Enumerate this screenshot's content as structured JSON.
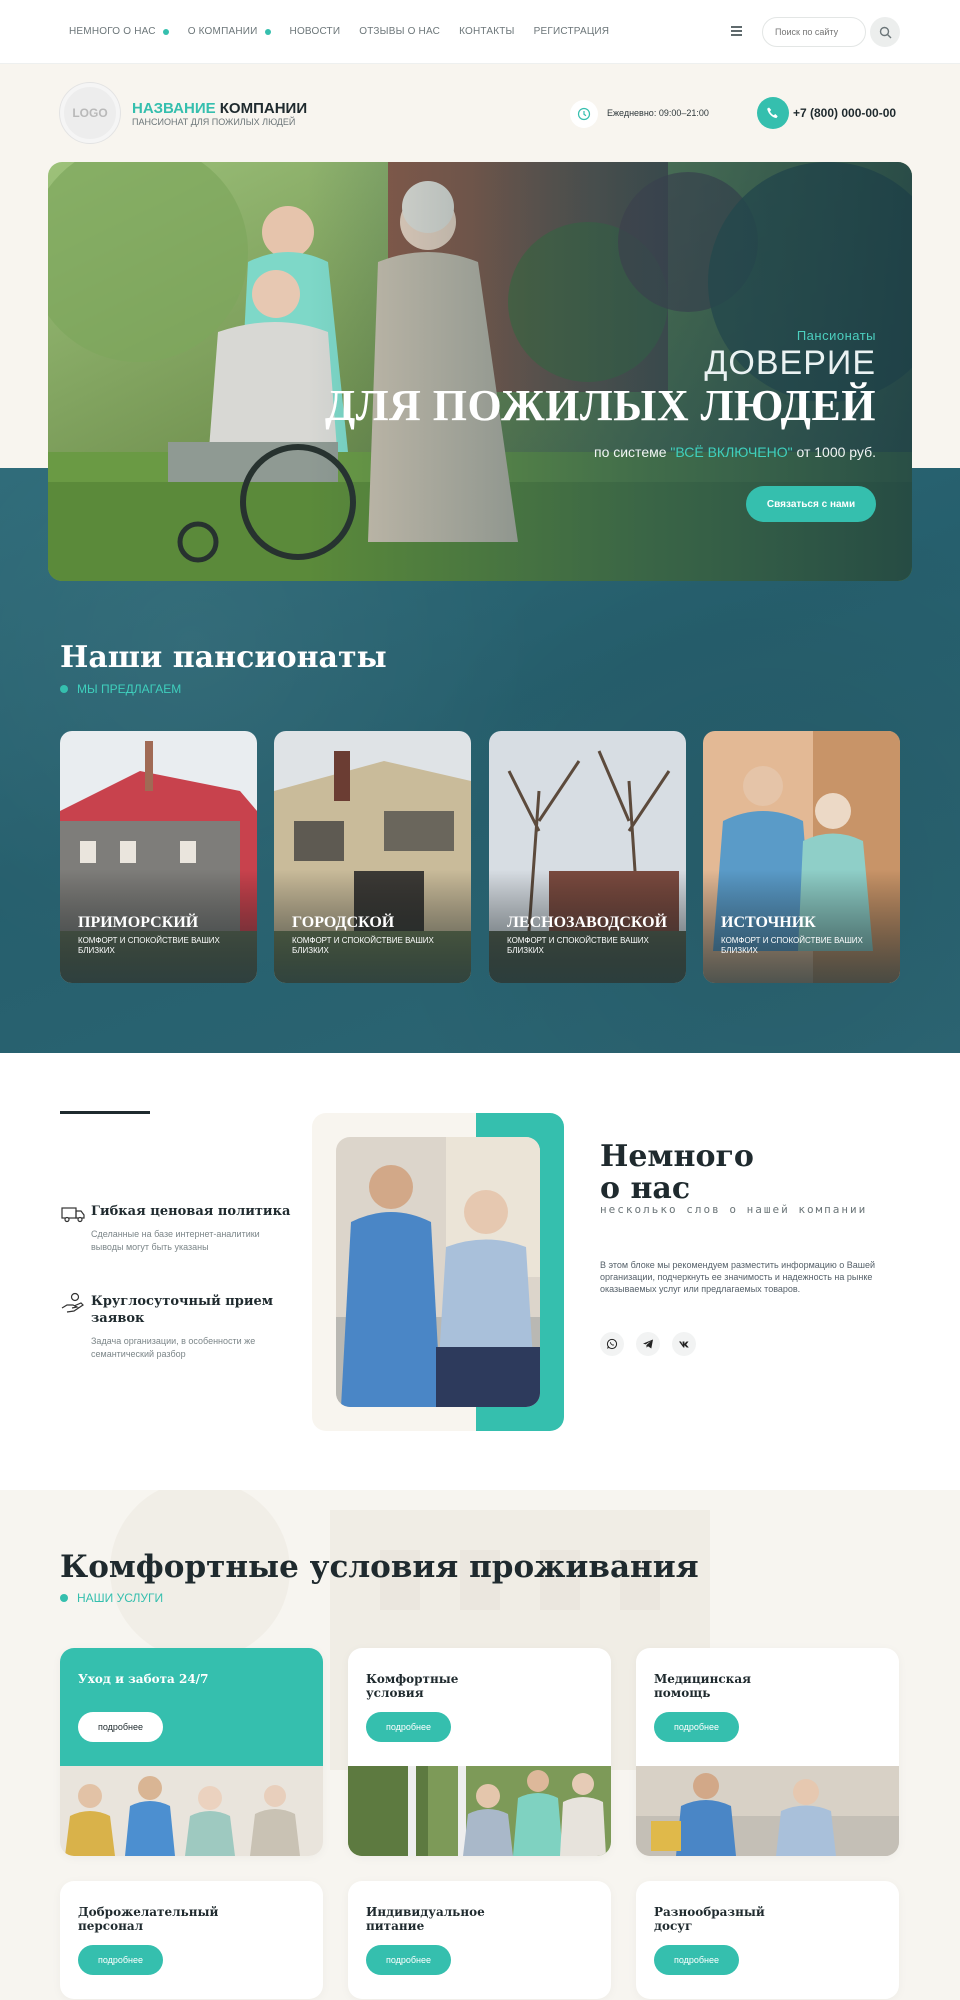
{
  "nav": {
    "items": [
      {
        "label": "НЕМНОГО О НАС",
        "dot": true
      },
      {
        "label": "О КОМПАНИИ",
        "dot": true
      },
      {
        "label": "НОВОСТИ",
        "dot": false
      },
      {
        "label": "ОТЗЫВЫ О НАС",
        "dot": false
      },
      {
        "label": "КОНТАКТЫ",
        "dot": false
      },
      {
        "label": "РЕГИСТРАЦИЯ",
        "dot": false
      }
    ],
    "search_placeholder": "Поиск по сайту"
  },
  "header": {
    "logo": "LOGO",
    "company_highlight": "НАЗВАНИЕ",
    "company_rest": "КОМПАНИИ",
    "company_sub": "ПАНСИОНАТ ДЛЯ ПОЖИЛЫХ ЛЮДЕЙ",
    "hours": "Ежедневно: 09:00–21:00",
    "phone": "+7 (800) 000-00-00"
  },
  "hero": {
    "kicker": "Пансионаты",
    "title1": "ДОВЕРИЕ",
    "title2": "ДЛЯ ПОЖИЛЫХ ЛЮДЕЙ",
    "sub_pre": "по системе",
    "sub_hl": "\"ВСЁ ВКЛЮЧЕНО\"",
    "sub_post": "от 1000 руб.",
    "button": "Связаться с нами"
  },
  "pansionaty": {
    "title": "Наши пансионаты",
    "kicker": "МЫ ПРЕДЛАГАЕМ",
    "cards": [
      {
        "name": "ПРИМОРСКИЙ",
        "desc": "КОМФОРТ И СПОКОЙСТВИЕ ВАШИХ БЛИЗКИХ"
      },
      {
        "name": "ГОРОДСКОЙ",
        "desc": "КОМФОРТ И СПОКОЙСТВИЕ ВАШИХ БЛИЗКИХ"
      },
      {
        "name": "ЛЕСНОЗАВОДСКОЙ",
        "desc": "КОМФОРТ И СПОКОЙСТВИЕ ВАШИХ БЛИЗКИХ"
      },
      {
        "name": "ИСТОЧНИК",
        "desc": "КОМФОРТ И СПОКОЙСТВИЕ ВАШИХ БЛИЗКИХ"
      }
    ]
  },
  "about": {
    "features": [
      {
        "title": "Гибкая ценовая политика",
        "desc": "Сделанные на базе интернет-аналитики выводы могут быть указаны"
      },
      {
        "title": "Круглосуточный прием заявок",
        "desc": "Задача организации, в особенности же семантический разбор"
      }
    ],
    "heading1": "Немного",
    "heading2": "о нас",
    "subheading": "несколько слов о нашей компании",
    "text": "В этом блоке мы рекомендуем разместить информацию о Вашей организации, подчеркнуть ее значимость и надежность на рынке оказываемых услуг или предлагаемых товаров."
  },
  "services": {
    "title": "Комфортные условия проживания",
    "kicker": "НАШИ УСЛУГИ",
    "button": "подробнее",
    "items": [
      {
        "title": "Уход и забота 24/7"
      },
      {
        "title": "Комфортные условия"
      },
      {
        "title": "Медицинская помощь"
      },
      {
        "title": "Доброжелательный персонал"
      },
      {
        "title": "Индивидуальное питание"
      },
      {
        "title": "Разнообразный досуг"
      }
    ]
  },
  "colors": {
    "accent": "#35bfae",
    "dark": "#2a6572",
    "cream": "#f8f5ef"
  }
}
